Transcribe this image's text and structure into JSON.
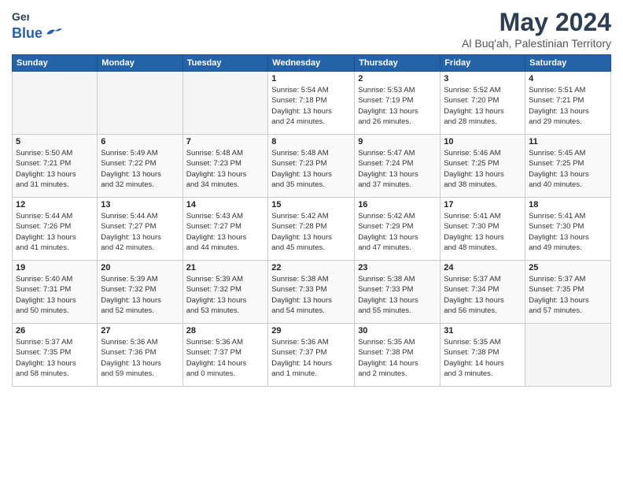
{
  "header": {
    "logo_line1": "General",
    "logo_line2": "Blue",
    "title": "May 2024",
    "subtitle": "Al Buq'ah, Palestinian Territory"
  },
  "days_of_week": [
    "Sunday",
    "Monday",
    "Tuesday",
    "Wednesday",
    "Thursday",
    "Friday",
    "Saturday"
  ],
  "weeks": [
    [
      {
        "day": "",
        "info": ""
      },
      {
        "day": "",
        "info": ""
      },
      {
        "day": "",
        "info": ""
      },
      {
        "day": "1",
        "info": "Sunrise: 5:54 AM\nSunset: 7:18 PM\nDaylight: 13 hours\nand 24 minutes."
      },
      {
        "day": "2",
        "info": "Sunrise: 5:53 AM\nSunset: 7:19 PM\nDaylight: 13 hours\nand 26 minutes."
      },
      {
        "day": "3",
        "info": "Sunrise: 5:52 AM\nSunset: 7:20 PM\nDaylight: 13 hours\nand 28 minutes."
      },
      {
        "day": "4",
        "info": "Sunrise: 5:51 AM\nSunset: 7:21 PM\nDaylight: 13 hours\nand 29 minutes."
      }
    ],
    [
      {
        "day": "5",
        "info": "Sunrise: 5:50 AM\nSunset: 7:21 PM\nDaylight: 13 hours\nand 31 minutes."
      },
      {
        "day": "6",
        "info": "Sunrise: 5:49 AM\nSunset: 7:22 PM\nDaylight: 13 hours\nand 32 minutes."
      },
      {
        "day": "7",
        "info": "Sunrise: 5:48 AM\nSunset: 7:23 PM\nDaylight: 13 hours\nand 34 minutes."
      },
      {
        "day": "8",
        "info": "Sunrise: 5:48 AM\nSunset: 7:23 PM\nDaylight: 13 hours\nand 35 minutes."
      },
      {
        "day": "9",
        "info": "Sunrise: 5:47 AM\nSunset: 7:24 PM\nDaylight: 13 hours\nand 37 minutes."
      },
      {
        "day": "10",
        "info": "Sunrise: 5:46 AM\nSunset: 7:25 PM\nDaylight: 13 hours\nand 38 minutes."
      },
      {
        "day": "11",
        "info": "Sunrise: 5:45 AM\nSunset: 7:25 PM\nDaylight: 13 hours\nand 40 minutes."
      }
    ],
    [
      {
        "day": "12",
        "info": "Sunrise: 5:44 AM\nSunset: 7:26 PM\nDaylight: 13 hours\nand 41 minutes."
      },
      {
        "day": "13",
        "info": "Sunrise: 5:44 AM\nSunset: 7:27 PM\nDaylight: 13 hours\nand 42 minutes."
      },
      {
        "day": "14",
        "info": "Sunrise: 5:43 AM\nSunset: 7:27 PM\nDaylight: 13 hours\nand 44 minutes."
      },
      {
        "day": "15",
        "info": "Sunrise: 5:42 AM\nSunset: 7:28 PM\nDaylight: 13 hours\nand 45 minutes."
      },
      {
        "day": "16",
        "info": "Sunrise: 5:42 AM\nSunset: 7:29 PM\nDaylight: 13 hours\nand 47 minutes."
      },
      {
        "day": "17",
        "info": "Sunrise: 5:41 AM\nSunset: 7:30 PM\nDaylight: 13 hours\nand 48 minutes."
      },
      {
        "day": "18",
        "info": "Sunrise: 5:41 AM\nSunset: 7:30 PM\nDaylight: 13 hours\nand 49 minutes."
      }
    ],
    [
      {
        "day": "19",
        "info": "Sunrise: 5:40 AM\nSunset: 7:31 PM\nDaylight: 13 hours\nand 50 minutes."
      },
      {
        "day": "20",
        "info": "Sunrise: 5:39 AM\nSunset: 7:32 PM\nDaylight: 13 hours\nand 52 minutes."
      },
      {
        "day": "21",
        "info": "Sunrise: 5:39 AM\nSunset: 7:32 PM\nDaylight: 13 hours\nand 53 minutes."
      },
      {
        "day": "22",
        "info": "Sunrise: 5:38 AM\nSunset: 7:33 PM\nDaylight: 13 hours\nand 54 minutes."
      },
      {
        "day": "23",
        "info": "Sunrise: 5:38 AM\nSunset: 7:33 PM\nDaylight: 13 hours\nand 55 minutes."
      },
      {
        "day": "24",
        "info": "Sunrise: 5:37 AM\nSunset: 7:34 PM\nDaylight: 13 hours\nand 56 minutes."
      },
      {
        "day": "25",
        "info": "Sunrise: 5:37 AM\nSunset: 7:35 PM\nDaylight: 13 hours\nand 57 minutes."
      }
    ],
    [
      {
        "day": "26",
        "info": "Sunrise: 5:37 AM\nSunset: 7:35 PM\nDaylight: 13 hours\nand 58 minutes."
      },
      {
        "day": "27",
        "info": "Sunrise: 5:36 AM\nSunset: 7:36 PM\nDaylight: 13 hours\nand 59 minutes."
      },
      {
        "day": "28",
        "info": "Sunrise: 5:36 AM\nSunset: 7:37 PM\nDaylight: 14 hours\nand 0 minutes."
      },
      {
        "day": "29",
        "info": "Sunrise: 5:36 AM\nSunset: 7:37 PM\nDaylight: 14 hours\nand 1 minute."
      },
      {
        "day": "30",
        "info": "Sunrise: 5:35 AM\nSunset: 7:38 PM\nDaylight: 14 hours\nand 2 minutes."
      },
      {
        "day": "31",
        "info": "Sunrise: 5:35 AM\nSunset: 7:38 PM\nDaylight: 14 hours\nand 3 minutes."
      },
      {
        "day": "",
        "info": ""
      }
    ]
  ]
}
